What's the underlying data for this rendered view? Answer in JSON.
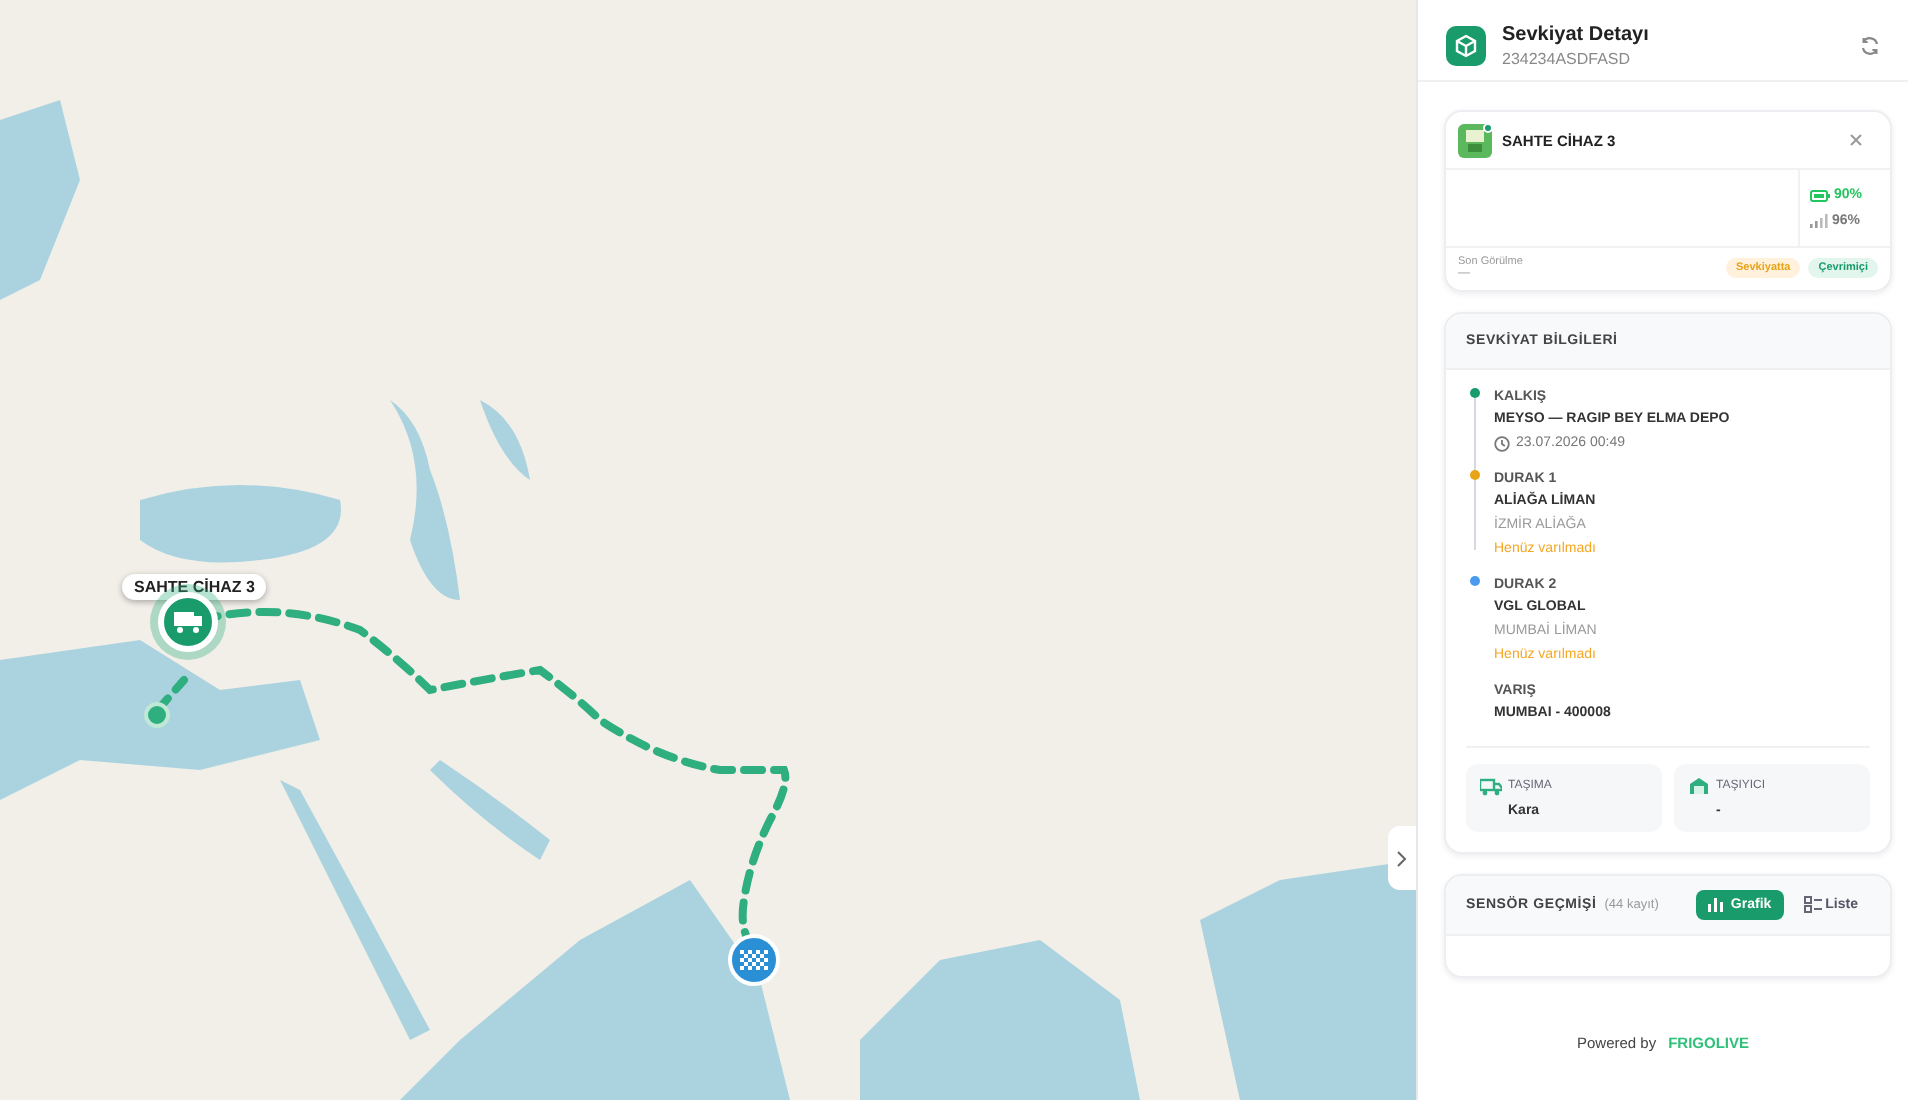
{
  "map": {
    "marker_label": "SAHTE CİHAZ 3"
  },
  "panel": {
    "title": "Sevkiyat Detayı",
    "subtitle": "234234ASDFASD"
  },
  "device": {
    "name": "SAHTE CİHAZ 3",
    "battery": "90%",
    "signal": "96%",
    "last_seen_label": "Son Görülme",
    "last_seen": "—",
    "badges": [
      {
        "label": "Sevkiyatta",
        "kind": "shipping"
      },
      {
        "label": "Çevrimiçi",
        "kind": "online"
      }
    ]
  },
  "shipment": {
    "title": "SEVKİYAT BİLGİLERİ",
    "stops": [
      {
        "heading": "KALKIŞ",
        "name": "MEYSO — RAGIP BEY ELMA DEPO",
        "time": "23.07.2026 00:49",
        "color": "#1a9b6c"
      },
      {
        "heading": "DURAK 1",
        "name": "ALİAĞA LİMAN",
        "place": "İZMİR ALİAĞA",
        "status": "Henüz varılmadı",
        "color": "#e8a317"
      },
      {
        "heading": "DURAK 2",
        "name": "VGL GLOBAL",
        "place": "MUMBAİ LİMAN",
        "status": "Henüz varılmadı",
        "color": "#4a9bf0"
      },
      {
        "heading": "VARIŞ",
        "name": "MUMBAI - 400008"
      }
    ],
    "info": [
      {
        "label": "TAŞIMA",
        "value": "Kara",
        "kind": "transport"
      },
      {
        "label": "TAŞIYICI",
        "value": "-",
        "kind": "carrier"
      }
    ]
  },
  "sensor": {
    "title": "SENSÖR GEÇMİŞİ",
    "count": "(44 kayıt)",
    "tabs": [
      {
        "label": "Grafik",
        "kind": "chart",
        "selected": true
      },
      {
        "label": "Liste",
        "kind": "list",
        "selected": false
      }
    ]
  },
  "footer": {
    "prefix": "Powered by",
    "brand": "FRIGOLIVE"
  }
}
